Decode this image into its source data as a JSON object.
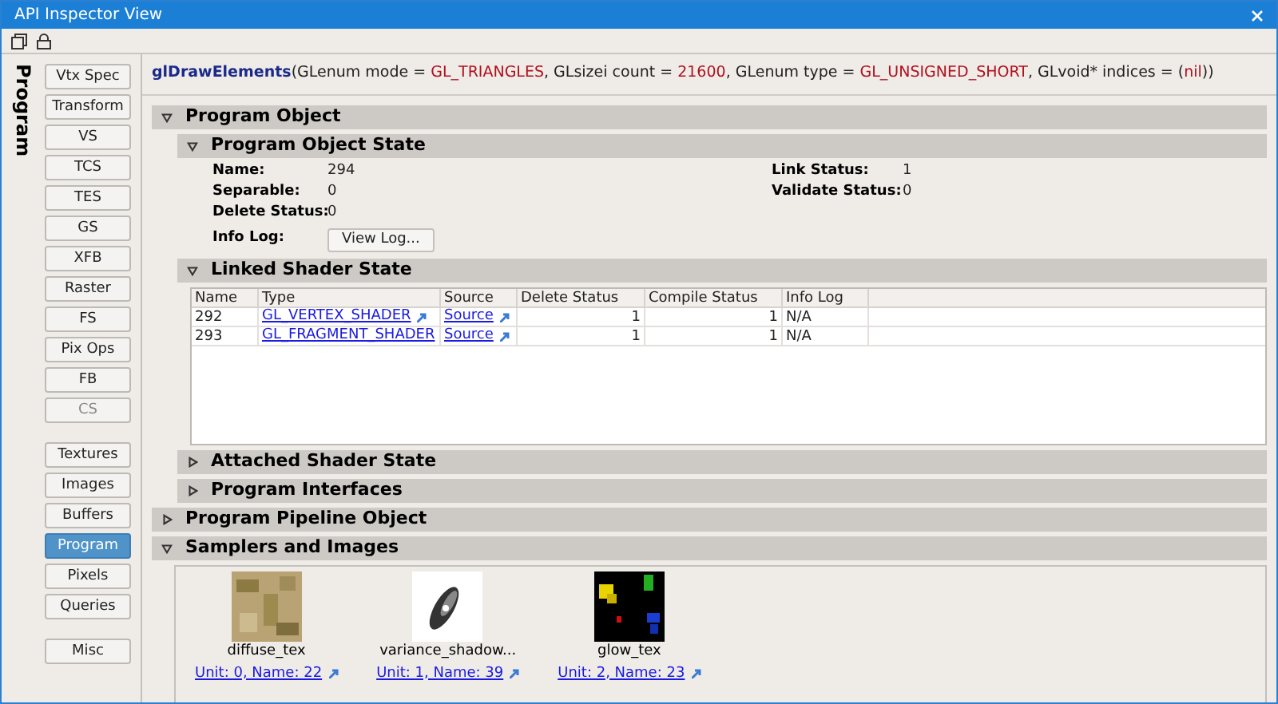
{
  "window": {
    "title": "API Inspector View"
  },
  "sidebar": {
    "label": "Program",
    "groups": [
      [
        {
          "label": "Vtx Spec",
          "selected": false,
          "disabled": false
        },
        {
          "label": "Transform",
          "selected": false,
          "disabled": false
        },
        {
          "label": "VS",
          "selected": false,
          "disabled": false
        },
        {
          "label": "TCS",
          "selected": false,
          "disabled": false
        },
        {
          "label": "TES",
          "selected": false,
          "disabled": false
        },
        {
          "label": "GS",
          "selected": false,
          "disabled": false
        },
        {
          "label": "XFB",
          "selected": false,
          "disabled": false
        },
        {
          "label": "Raster",
          "selected": false,
          "disabled": false
        },
        {
          "label": "FS",
          "selected": false,
          "disabled": false
        },
        {
          "label": "Pix Ops",
          "selected": false,
          "disabled": false
        },
        {
          "label": "FB",
          "selected": false,
          "disabled": false
        },
        {
          "label": "CS",
          "selected": false,
          "disabled": true
        }
      ],
      [
        {
          "label": "Textures",
          "selected": false,
          "disabled": false
        },
        {
          "label": "Images",
          "selected": false,
          "disabled": false
        },
        {
          "label": "Buffers",
          "selected": false,
          "disabled": false
        },
        {
          "label": "Program",
          "selected": true,
          "disabled": false
        },
        {
          "label": "Pixels",
          "selected": false,
          "disabled": false
        },
        {
          "label": "Queries",
          "selected": false,
          "disabled": false
        }
      ],
      [
        {
          "label": "Misc",
          "selected": false,
          "disabled": false
        }
      ]
    ]
  },
  "call": [
    {
      "kind": "function",
      "text": "glDrawElements"
    },
    {
      "kind": "plain",
      "text": "(GLenum mode = "
    },
    {
      "kind": "value",
      "text": "GL_TRIANGLES"
    },
    {
      "kind": "plain",
      "text": ", GLsizei count = "
    },
    {
      "kind": "value",
      "text": "21600"
    },
    {
      "kind": "plain",
      "text": ", GLenum type = "
    },
    {
      "kind": "value",
      "text": "GL_UNSIGNED_SHORT"
    },
    {
      "kind": "plain",
      "text": ", GLvoid* indices = "
    },
    {
      "kind": "plain",
      "text": "("
    },
    {
      "kind": "value",
      "text": "nil"
    },
    {
      "kind": "plain",
      "text": "))"
    }
  ],
  "program_object": {
    "title": "Program Object",
    "expanded": true,
    "state": {
      "title": "Program Object State",
      "expanded": true,
      "left": [
        {
          "label": "Name:",
          "value": "294"
        },
        {
          "label": "Separable:",
          "value": "0"
        },
        {
          "label": "Delete Status:",
          "value": "0"
        }
      ],
      "right": [
        {
          "label": "Link Status:",
          "value": "1"
        },
        {
          "label": "Validate Status:",
          "value": "0"
        }
      ],
      "info_log": {
        "label": "Info Log:",
        "button": "View Log..."
      }
    },
    "linked": {
      "title": "Linked Shader State",
      "expanded": true,
      "columns": [
        "Name",
        "Type",
        "Source",
        "Delete Status",
        "Compile Status",
        "Info Log"
      ],
      "rows": [
        {
          "name": "292",
          "type": "GL_VERTEX_SHADER",
          "source": "Source",
          "delete_status": "1",
          "compile_status": "1",
          "info_log": "N/A"
        },
        {
          "name": "293",
          "type": "GL_FRAGMENT_SHADER",
          "source": "Source",
          "delete_status": "1",
          "compile_status": "1",
          "info_log": "N/A"
        }
      ]
    },
    "collapsed": [
      {
        "title": "Attached Shader State",
        "expanded": false
      },
      {
        "title": "Program Interfaces",
        "expanded": false
      }
    ]
  },
  "pipeline": {
    "title": "Program Pipeline Object",
    "expanded": false
  },
  "samplers": {
    "title": "Samplers and Images",
    "expanded": true,
    "items": [
      {
        "name": "diffuse_tex",
        "link": "Unit: 0, Name: 22",
        "kind": "picture"
      },
      {
        "name": "variance_shadow...",
        "link": "Unit: 1, Name: 39",
        "kind": "picture"
      },
      {
        "name": "glow_tex",
        "link": "Unit: 2, Name: 23",
        "kind": "picture"
      }
    ]
  }
}
